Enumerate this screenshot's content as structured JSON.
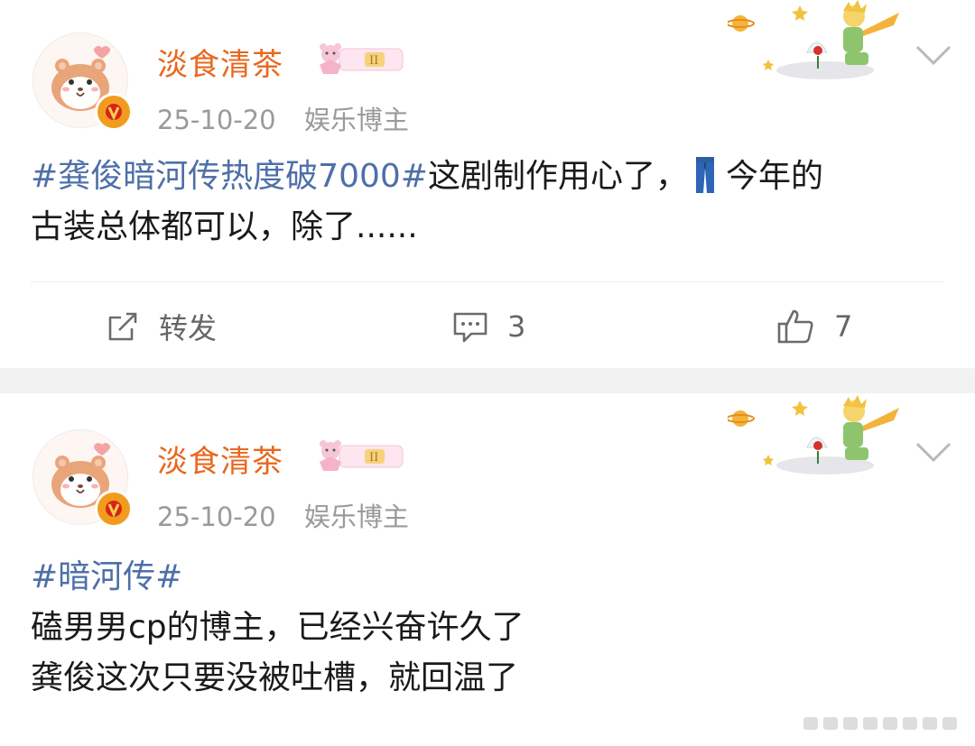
{
  "posts": [
    {
      "username": "淡食清茶",
      "date": "25-10-20",
      "category": "娱乐博主",
      "text_hashtag": "#龚俊暗河传热度破7000#",
      "text_line1_rest": "这剧制作用心了，",
      "text_line1_tail": "今年的",
      "text_line2": "古装总体都可以，除了......",
      "actions": {
        "repost_label": "转发",
        "comment_count": "3",
        "like_count": "7"
      }
    },
    {
      "username": "淡食清茶",
      "date": "25-10-20",
      "category": "娱乐博主",
      "text_hashtag": "#暗河传#",
      "text_line2": "磕男男cp的博主，已经兴奋许久了",
      "text_line3": "龚俊这次只要没被吐槽，就回温了"
    }
  ],
  "icons": {
    "avatar": "hamster-avatar",
    "verified": "verified-v-badge",
    "member": "member-badge-bear",
    "decoration": "little-prince-decoration",
    "dropdown": "chevron-down-icon",
    "repost": "repost-icon",
    "comment": "comment-icon",
    "like": "thumbs-up-icon",
    "emoji": "jeans-emoji"
  },
  "colors": {
    "username": "#e8681f",
    "hashtag": "#4e6fa8",
    "meta": "#9a9a9a",
    "text": "#1a1a1a",
    "verified": "#f29c1f"
  }
}
